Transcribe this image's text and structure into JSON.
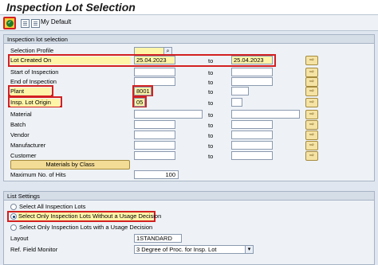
{
  "title": "Inspection Lot Selection",
  "toolbar": {
    "my_default": "My Default"
  },
  "selection": {
    "header": "Inspection lot selection",
    "profile_label": "Selection Profile",
    "to_label": "to",
    "rows": {
      "lot_created_on": {
        "label": "Lot Created On",
        "from": "25.04.2023",
        "to": "25.04.2023"
      },
      "start_of_inspection": {
        "label": "Start of Inspection",
        "from": "",
        "to": ""
      },
      "end_of_inspection": {
        "label": "End of Inspection",
        "from": "",
        "to": ""
      },
      "plant": {
        "label": "Plant",
        "from": "8001",
        "to": ""
      },
      "insp_lot_origin": {
        "label": "Insp. Lot Origin",
        "from": "05",
        "to": ""
      },
      "material": {
        "label": "Material",
        "from": "",
        "to": ""
      },
      "batch": {
        "label": "Batch",
        "from": "",
        "to": ""
      },
      "vendor": {
        "label": "Vendor",
        "from": "",
        "to": ""
      },
      "manufacturer": {
        "label": "Manufacturer",
        "from": "",
        "to": ""
      },
      "customer": {
        "label": "Customer",
        "from": "",
        "to": ""
      }
    },
    "materials_by_class": "Materials by Class",
    "max_hits_label": "Maximum No. of Hits",
    "max_hits_value": "100"
  },
  "list_settings": {
    "header": "List Settings",
    "option_all": "Select All Inspection Lots",
    "option_without_ud": "Select Only Inspection Lots Without a Usage Decision",
    "option_with_ud": "Select Only Inspection Lots with a Usage Decision",
    "selected_option": "option_without_ud",
    "layout_label": "Layout",
    "layout_value": "1STANDARD",
    "ref_field_label": "Ref. Field Monitor",
    "ref_field_value": "3 Degree of Proc. for Insp. Lot"
  }
}
